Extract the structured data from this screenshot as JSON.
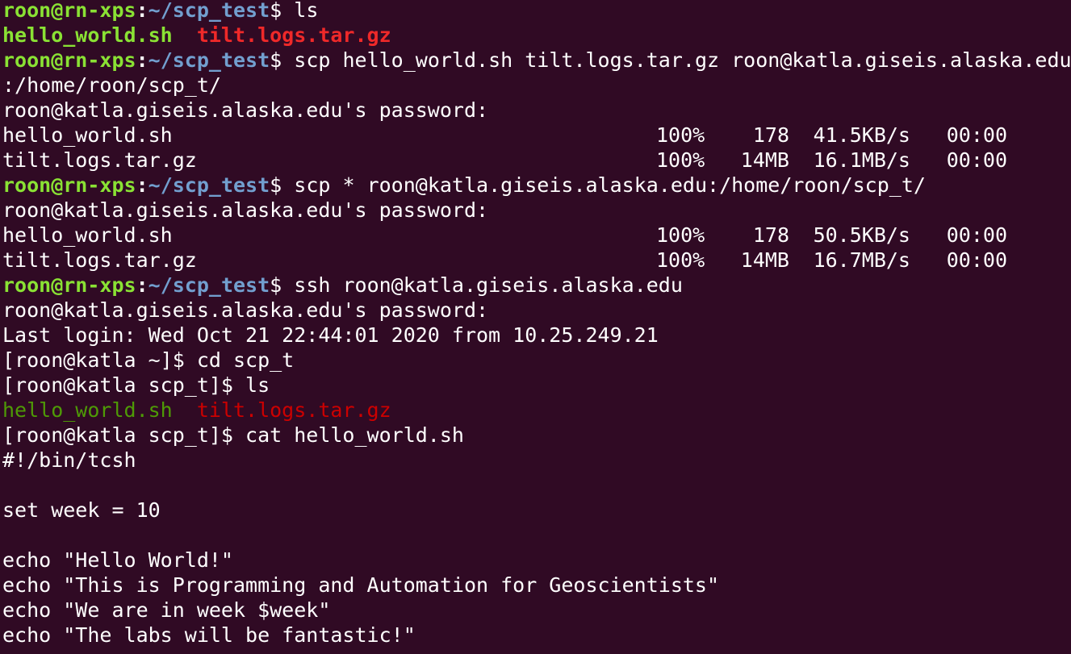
{
  "prompt": {
    "user_host": "roon@rn-xps",
    "colon": ":",
    "path": "~/scp_test",
    "dollar": "$"
  },
  "lines": [
    {
      "type": "prompt",
      "cmd": " ls"
    },
    {
      "type": "ls_bold",
      "exec": "hello_world.sh",
      "sep": "  ",
      "archive": "tilt.logs.tar.gz"
    },
    {
      "type": "prompt",
      "cmd": " scp hello_world.sh tilt.logs.tar.gz roon@katla.giseis.alaska.edu"
    },
    {
      "type": "text",
      "text": ":/home/roon/scp_t/"
    },
    {
      "type": "text",
      "text": "roon@katla.giseis.alaska.edu's password: "
    },
    {
      "type": "transfer",
      "file": "hello_world.sh",
      "pct": "100%",
      "size": "178",
      "rate": "41.5KB/s",
      "time": "00:00"
    },
    {
      "type": "transfer",
      "file": "tilt.logs.tar.gz",
      "pct": "100%",
      "size": "14MB",
      "rate": "16.1MB/s",
      "time": "00:00"
    },
    {
      "type": "prompt",
      "cmd": " scp * roon@katla.giseis.alaska.edu:/home/roon/scp_t/"
    },
    {
      "type": "text",
      "text": "roon@katla.giseis.alaska.edu's password: "
    },
    {
      "type": "transfer",
      "file": "hello_world.sh",
      "pct": "100%",
      "size": "178",
      "rate": "50.5KB/s",
      "time": "00:00"
    },
    {
      "type": "transfer",
      "file": "tilt.logs.tar.gz",
      "pct": "100%",
      "size": "14MB",
      "rate": "16.7MB/s",
      "time": "00:00"
    },
    {
      "type": "prompt",
      "cmd": " ssh roon@katla.giseis.alaska.edu"
    },
    {
      "type": "text",
      "text": "roon@katla.giseis.alaska.edu's password: "
    },
    {
      "type": "text",
      "text": "Last login: Wed Oct 21 22:44:01 2020 from 10.25.249.21"
    },
    {
      "type": "text",
      "text": "[roon@katla ~]$ cd scp_t"
    },
    {
      "type": "text",
      "text": "[roon@katla scp_t]$ ls"
    },
    {
      "type": "ls_plain",
      "exec": "hello_world.sh",
      "sep": "  ",
      "archive": "tilt.logs.tar.gz"
    },
    {
      "type": "text",
      "text": "[roon@katla scp_t]$ cat hello_world.sh"
    },
    {
      "type": "text",
      "text": "#!/bin/tcsh"
    },
    {
      "type": "text",
      "text": ""
    },
    {
      "type": "text",
      "text": "set week = 10"
    },
    {
      "type": "text",
      "text": ""
    },
    {
      "type": "text",
      "text": "echo \"Hello World!\""
    },
    {
      "type": "text",
      "text": "echo \"This is Programming and Automation for Geoscientists\""
    },
    {
      "type": "text",
      "text": "echo \"We are in week $week\""
    },
    {
      "type": "text",
      "text": "echo \"The labs will be fantastic!\""
    }
  ]
}
